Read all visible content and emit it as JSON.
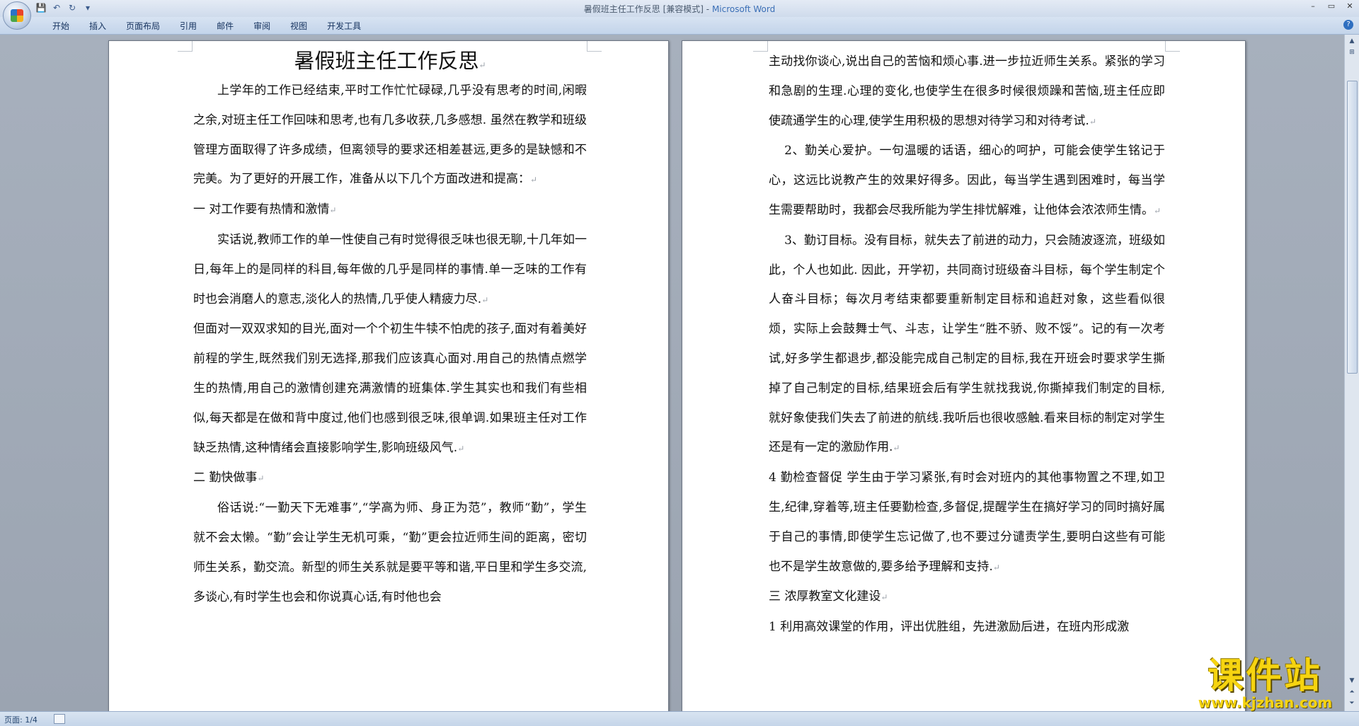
{
  "window": {
    "title": "暑假班主任工作反思 [兼容模式]",
    "title_separator": " - ",
    "app_name": "Microsoft Word"
  },
  "quick_access": {
    "save_icon": "💾",
    "undo_icon": "↶",
    "redo_icon": "↻",
    "customize_icon": "▾"
  },
  "window_controls": {
    "minimize": "–",
    "restore": "▭",
    "close": "✕"
  },
  "ribbon": {
    "tabs": [
      "开始",
      "插入",
      "页面布局",
      "引用",
      "邮件",
      "审阅",
      "视图",
      "开发工具"
    ],
    "help_icon": "?"
  },
  "document": {
    "title": "暑假班主任工作反思",
    "left_page": [
      "上学年的工作已经结束,平时工作忙忙碌碌,几乎没有思考的时间,闲暇之余,对班主任工作回味和思考,也有几多收获,几多感想. 虽然在教学和班级管理方面取得了许多成绩，但离领导的要求还相差甚远,更多的是缺憾和不完美。为了更好的开展工作，准备从以下几个方面改进和提高：",
      "一 对工作要有热情和激情",
      "实话说,教师工作的单一性使自己有时觉得很乏味也很无聊,十几年如一日,每年上的是同样的科目,每年做的几乎是同样的事情.单一乏味的工作有时也会消磨人的意志,淡化人的热情,几乎使人精疲力尽.",
      "但面对一双双求知的目光,面对一个个初生牛犊不怕虎的孩子,面对有着美好前程的学生,既然我们别无选择,那我们应该真心面对.用自己的热情点燃学生的热情,用自己的激情创建充满激情的班集体.学生其实也和我们有些相似,每天都是在做和背中度过,他们也感到很乏味,很单调.如果班主任对工作缺乏热情,这种情绪会直接影响学生,影响班级风气.",
      "二 勤快做事",
      "俗话说:“一勤天下无难事”,“学高为师、身正为范”，教师“勤”，学生就不会太懒。“勤”会让学生无机可乘，“勤”更会拉近师生间的距离，密切师生关系，勤交流。新型的师生关系就是要平等和谐,平日里和学生多交流,多谈心,有时学生也会和你说真心话,有时他也会"
    ],
    "right_page": [
      "主动找你谈心,说出自己的苦恼和烦心事.进一步拉近师生关系。紧张的学习和急剧的生理.心理的变化,也使学生在很多时候很烦躁和苦恼,班主任应即使疏通学生的心理,使学生用积极的思想对待学习和对待考试.",
      "2、勤关心爱护。一句温暖的话语，细心的呵护，可能会使学生铭记于心，这远比说教产生的效果好得多。因此，每当学生遇到困难时，每当学生需要帮助时，我都会尽我所能为学生排忧解难，让他体会浓浓师生情。",
      "3、勤订目标。没有目标，就失去了前进的动力，只会随波逐流，班级如此，个人也如此. 因此，开学初，共同商讨班级奋斗目标，每个学生制定个人奋斗目标；每次月考结束都要重新制定目标和追赶对象，这些看似很烦，实际上会鼓舞士气、斗志，让学生“胜不骄、败不馁”。记的有一次考试,好多学生都退步,都没能完成自己制定的目标,我在开班会时要求学生撕掉了自己制定的目标,结果班会后有学生就找我说,你撕掉我们制定的目标,就好象使我们失去了前进的航线.我听后也很收感触.看来目标的制定对学生还是有一定的激励作用.",
      "4 勤检查督促 学生由于学习紧张,有时会对班内的其他事物置之不理,如卫生,纪律,穿着等,班主任要勤检查,多督促,提醒学生在搞好学习的同时搞好属于自己的事情,即使学生忘记做了,也不要过分谴责学生,要明白这些有可能也不是学生故意做的,要多给予理解和支持.",
      "三 浓厚教室文化建设",
      "1 利用高效课堂的作用，评出优胜组，先进激励后进，在班内形成激"
    ],
    "paragraph_mark": "↵"
  },
  "status_bar": {
    "page_count": "页面: 1/4"
  },
  "watermark": {
    "main": "课件站",
    "url": "www.kjzhan.com"
  }
}
